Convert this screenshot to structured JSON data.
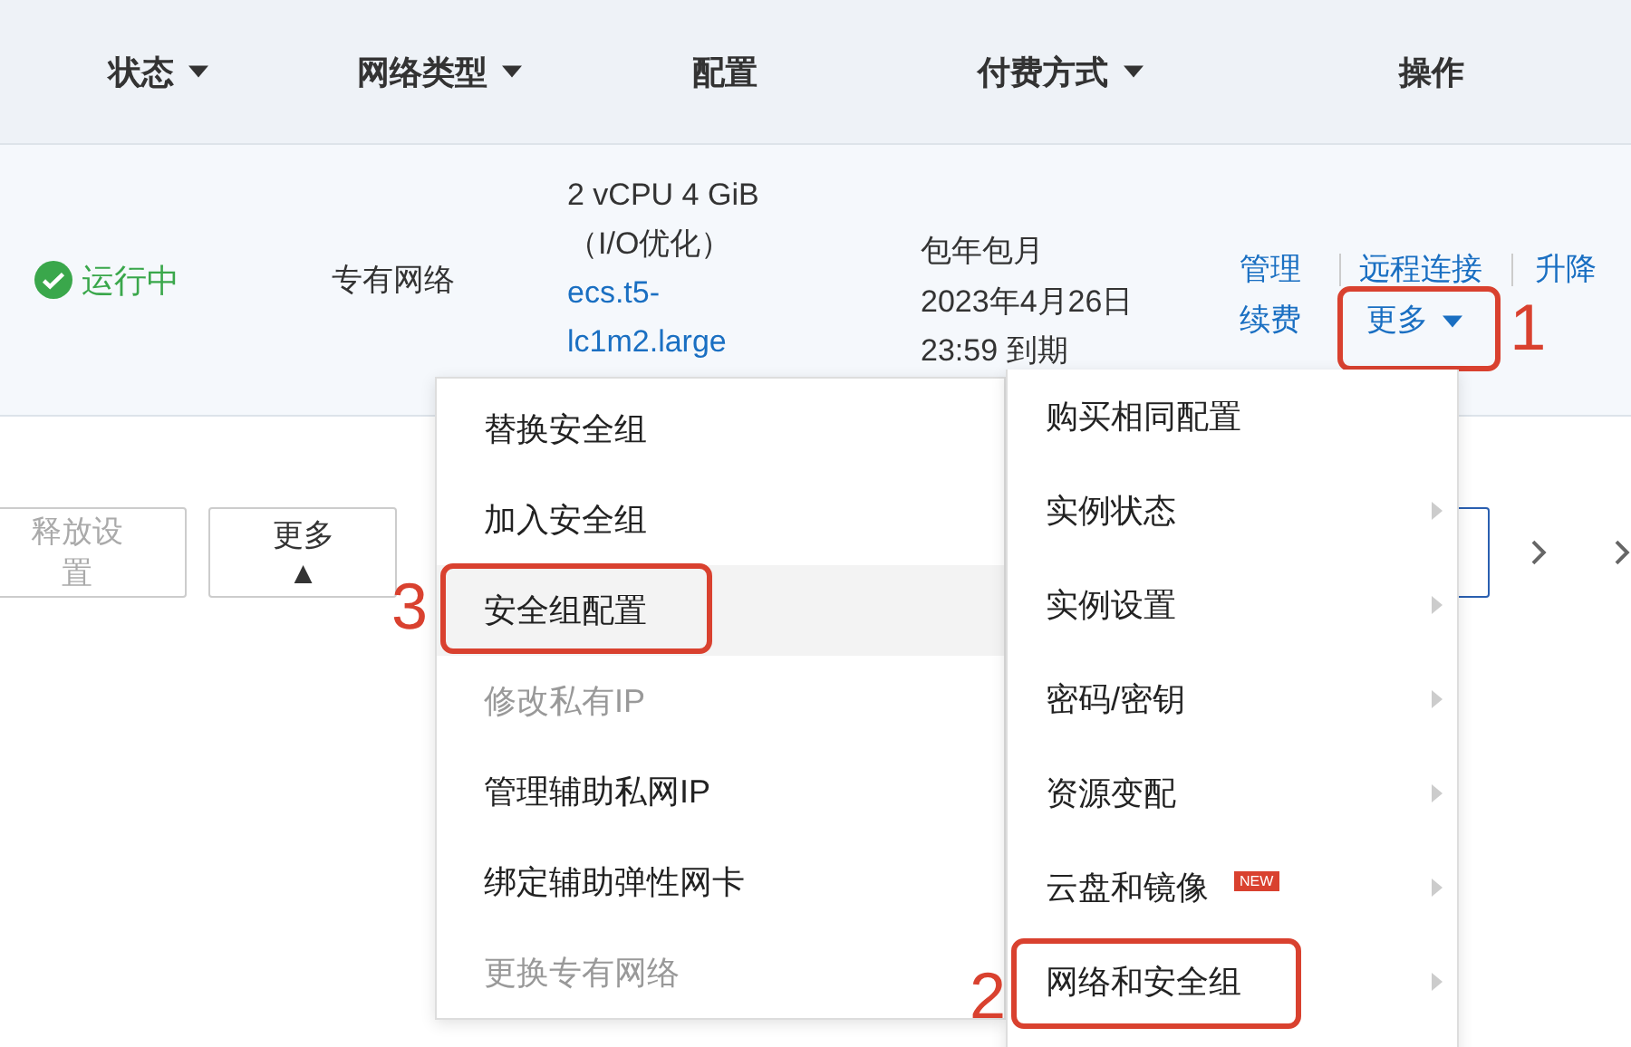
{
  "table": {
    "columns": [
      {
        "label": "状态",
        "filter": true
      },
      {
        "label": "网络类型",
        "filter": true
      },
      {
        "label": "配置",
        "filter": false
      },
      {
        "label": "付费方式",
        "filter": true
      },
      {
        "label": "操作",
        "filter": false
      }
    ],
    "rows": [
      {
        "status": "运行中",
        "network_type": "专有网络",
        "config": {
          "spec": "2 vCPU 4 GiB",
          "io": "（I/O优化）",
          "instance_type": "ecs.t5-lc1m2.large"
        },
        "payment": {
          "type": "包年包月",
          "expiry": "2023年4月26日 23:59 到期"
        },
        "actions": [
          {
            "label": "管理续费"
          },
          {
            "label": "远程连接"
          },
          {
            "label": "升降"
          }
        ],
        "more": {
          "label": "更多",
          "annotation": "1"
        }
      }
    ]
  },
  "toolbar": {
    "buttons": [
      {
        "label": "释放设置",
        "disabled": true
      },
      {
        "label": "更多▲",
        "disabled": false
      }
    ]
  },
  "submenu": {
    "items": [
      {
        "label": "替换安全组",
        "disabled": false,
        "selected": false
      },
      {
        "label": "加入安全组",
        "disabled": false,
        "selected": false
      },
      {
        "label": "安全组配置",
        "disabled": false,
        "selected": true,
        "annotation": "3"
      },
      {
        "label": "修改私有IP",
        "disabled": true,
        "selected": false
      },
      {
        "label": "管理辅助私网IP",
        "disabled": false,
        "selected": false
      },
      {
        "label": "绑定辅助弹性网卡",
        "disabled": false,
        "selected": false
      },
      {
        "label": "更换专有网络",
        "disabled": true,
        "selected": false
      }
    ]
  },
  "menu": {
    "items": [
      {
        "label": "购买相同配置",
        "has_submenu": false
      },
      {
        "label": "实例状态",
        "has_submenu": true
      },
      {
        "label": "实例设置",
        "has_submenu": true
      },
      {
        "label": "密码/密钥",
        "has_submenu": true
      },
      {
        "label": "资源变配",
        "has_submenu": true
      },
      {
        "label": "云盘和镜像",
        "has_submenu": true,
        "badge": "NEW"
      },
      {
        "label": "网络和安全组",
        "has_submenu": true,
        "annotation": "2"
      }
    ]
  }
}
